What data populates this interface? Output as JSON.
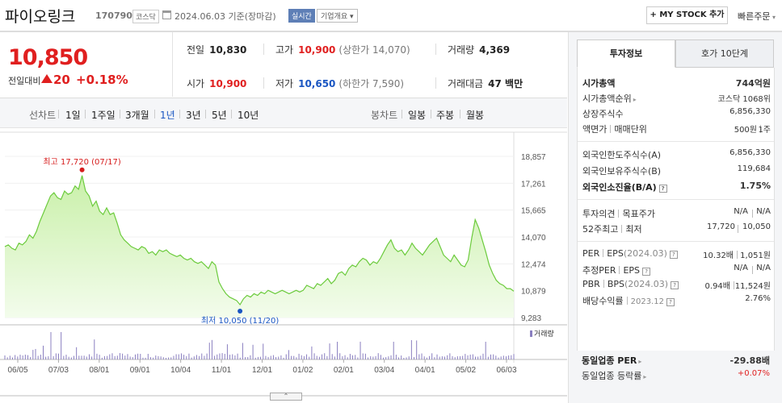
{
  "header": {
    "stock_name": "파이오링크",
    "stock_code": "170790",
    "market": "코스닥",
    "date": "2024.06.03",
    "date_suffix": "기준(장마감)",
    "realtime": "실시간",
    "company_overview": "기업개요",
    "mystock_button": "+ MY STOCK 추가",
    "quick_order": "빠른주문"
  },
  "price": {
    "current": "10,850",
    "change_label": "전일대비",
    "change": "20",
    "change_pct": "+0.18%"
  },
  "stats": {
    "prev_close": {
      "label": "전일",
      "value": "10,830"
    },
    "high": {
      "label": "고가",
      "value": "10,900",
      "sub": "(상한가 14,070)"
    },
    "volume": {
      "label": "거래량",
      "value": "4,369"
    },
    "open": {
      "label": "시가",
      "value": "10,900"
    },
    "low": {
      "label": "저가",
      "value": "10,650",
      "sub": "(하한가 7,590)"
    },
    "amount": {
      "label": "거래대금",
      "value": "47 백만"
    }
  },
  "period_bar": {
    "line_chart": "선차트",
    "periods": [
      "1일",
      "1주일",
      "3개월",
      "1년",
      "3년",
      "5년",
      "10년"
    ],
    "candle_chart": "봉차트",
    "candle_periods": [
      "일봉",
      "주봉",
      "월봉"
    ]
  },
  "chart_data": {
    "type": "area",
    "y_ticks": [
      "18,857",
      "17,261",
      "15,665",
      "14,070",
      "12,474",
      "10,879",
      "9,283"
    ],
    "ylim": [
      9283,
      18857
    ],
    "x_ticks": [
      "06/05",
      "07/03",
      "08/01",
      "09/01",
      "10/04",
      "11/01",
      "12/01",
      "01/02",
      "02/01",
      "03/04",
      "04/01",
      "05/02",
      "06/03"
    ],
    "max_annotation": "최고 17,720 (07/17)",
    "min_annotation": "최저 10,050 (11/20)",
    "max": {
      "date": "07/17",
      "value": 17720
    },
    "min": {
      "date": "11/20",
      "value": 10050
    },
    "series": [
      {
        "values": [
          13500,
          13600,
          13400,
          13300,
          13700,
          13600,
          13800,
          14200,
          14000,
          14400,
          15000,
          15500,
          16000,
          16500,
          16700,
          16400,
          16300,
          16800,
          16600,
          16700,
          17100,
          16900,
          17720,
          16800,
          16500,
          15900,
          16200,
          15600,
          15400,
          15800,
          15400,
          15500,
          14900,
          14200,
          13900,
          13700,
          13500,
          13400,
          13300,
          13500,
          13400,
          13100,
          13200,
          13000,
          13300,
          13200,
          13300,
          13100,
          13000,
          12900,
          13000,
          12800,
          12700,
          12800,
          12600,
          12500,
          12600,
          12400,
          12200,
          12600,
          12400,
          11400,
          11000,
          10700,
          10500,
          10400,
          10300,
          10050,
          10400,
          10600,
          10500,
          10700,
          10600,
          10800,
          10700,
          10900,
          10800,
          10700,
          10800,
          10900,
          10800,
          10700,
          10800,
          10900,
          10800,
          10900,
          11200,
          11100,
          11000,
          11300,
          11200,
          11400,
          11600,
          11300,
          11500,
          11900,
          12000,
          11800,
          12200,
          12400,
          12300,
          12600,
          12800,
          12700,
          12400,
          12600,
          12500,
          12800,
          13200,
          13600,
          13900,
          13400,
          13200,
          13300,
          13000,
          13300,
          13700,
          13400,
          13200,
          13000,
          13300,
          13600,
          13800,
          14000,
          13500,
          13000,
          12800,
          12600,
          13000,
          12700,
          12400,
          12300,
          12700,
          14000,
          15100,
          14600,
          13900,
          13200,
          12400,
          11900,
          11500,
          11300,
          11200,
          11000,
          11000,
          10850
        ]
      }
    ]
  },
  "volume_label": "거래량",
  "panel": {
    "tabs": [
      "투자정보",
      "호가 10단계"
    ],
    "market_cap": {
      "label": "시가총액",
      "value": "744억원"
    },
    "market_cap_rank": {
      "label": "시가총액순위",
      "value": "코스닥 1068위"
    },
    "listed_shares": {
      "label": "상장주식수",
      "value": "6,856,330"
    },
    "par_value": {
      "label": "액면가",
      "label2": "매매단위",
      "value": "500원",
      "value2": "1주"
    },
    "foreign_limit": {
      "label": "외국인한도주식수(A)",
      "value": "6,856,330"
    },
    "foreign_holding": {
      "label": "외국인보유주식수(B)",
      "value": "119,684"
    },
    "foreign_ratio": {
      "label": "외국인소진율(B/A)",
      "value": "1.75%"
    },
    "opinion": {
      "label": "투자의견",
      "label2": "목표주가",
      "value": "N/A",
      "value2": "N/A"
    },
    "week52": {
      "label": "52주최고",
      "label2": "최저",
      "value": "17,720",
      "value2": "10,050"
    },
    "per": {
      "label": "PER",
      "label2": "EPS",
      "period": "(2024.03)",
      "value": "10.32배",
      "value2": "1,051원"
    },
    "est_per": {
      "label": "추정PER",
      "label2": "EPS",
      "value": "N/A",
      "value2": "N/A"
    },
    "pbr": {
      "label": "PBR",
      "label2": "BPS",
      "period": "(2024.03)",
      "value": "0.94배",
      "value2": "11,524원"
    },
    "dividend": {
      "label": "배당수익률",
      "period": "2023.12",
      "value": "2.76%"
    },
    "sector_per": {
      "label": "동일업종 PER",
      "value": "-29.88배"
    },
    "sector_change": {
      "label": "동일업종 등락률",
      "value": "+0.07%"
    }
  }
}
